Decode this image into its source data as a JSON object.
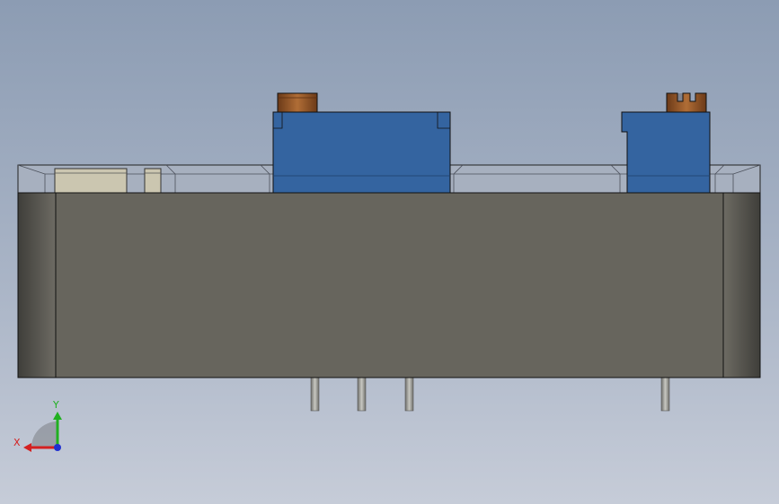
{
  "viewport": {
    "background_top": "#8c9cb3",
    "background_bottom": "#c6ccd8"
  },
  "model": {
    "base_color": "#67655d",
    "base_side_color": "#4c4b46",
    "glass_tray_color": "#a7b0bf",
    "component_color": "#3464a0",
    "knob_color": "#9a5a2a",
    "beige_part_color": "#cbc6b0",
    "pin_color": "#9a9a94",
    "pin_count": 4
  },
  "triad": {
    "x_label": "X",
    "y_label": "Y",
    "x_color": "#d42020",
    "y_color": "#20b020",
    "z_color": "#2030d0"
  }
}
